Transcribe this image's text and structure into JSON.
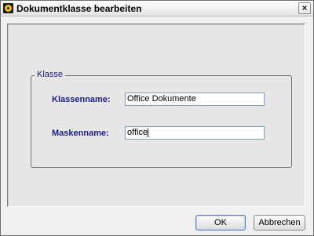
{
  "window": {
    "title": "Dokumentklasse bearbeiten",
    "close_label": "×"
  },
  "group": {
    "legend": "Klasse"
  },
  "fields": {
    "klassenname_label": "Klassenname:",
    "klassenname_value": "Office Dokumente",
    "maskenname_label": "Maskenname:",
    "maskenname_value": "office"
  },
  "buttons": {
    "ok_label": "OK",
    "cancel_label": "Abbrechen"
  },
  "icons": {
    "app": "app-icon",
    "close": "close-icon"
  },
  "colors": {
    "label_text": "#1d1d8b",
    "panel_bg": "#e6e6e6",
    "window_bg": "#f0f0f0"
  }
}
